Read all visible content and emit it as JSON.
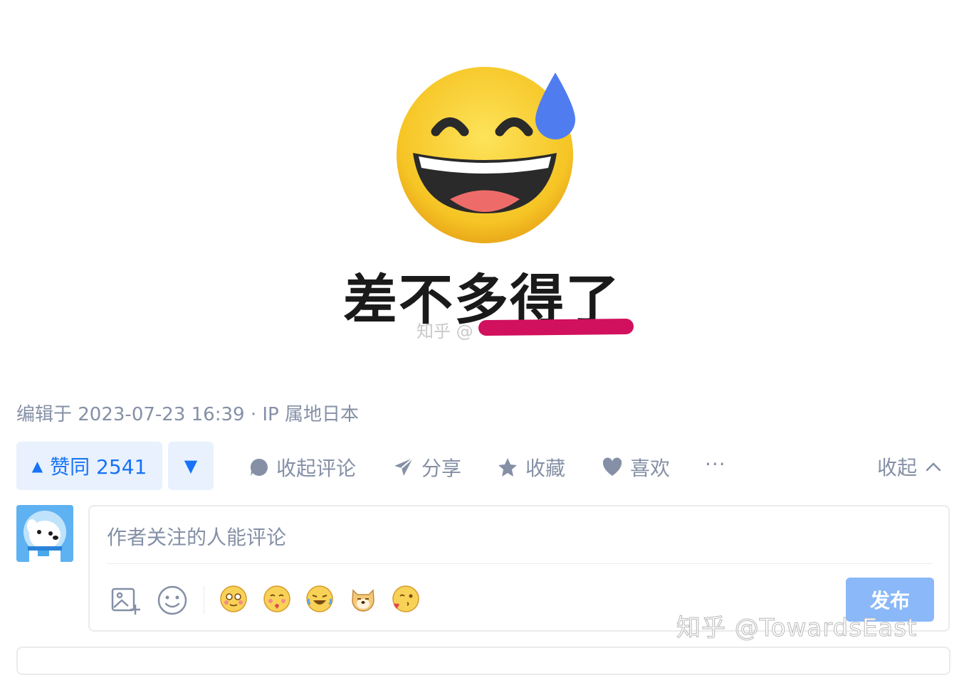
{
  "meme": {
    "caption": "差不多得了",
    "watermark_prefix": "知乎 @",
    "emoji_icon": "grinning-face-with-sweat-icon",
    "redaction_color": "#d1105e"
  },
  "post_meta": {
    "text": "编辑于 2023-07-23 16:39 · IP 属地日本"
  },
  "actions": {
    "upvote_label": "赞同 2541",
    "upvote_icon": "triangle-up-icon",
    "downvote_icon": "triangle-down-icon",
    "comment_label": "收起评论",
    "comment_icon": "comment-bubble-icon",
    "share_label": "分享",
    "share_icon": "paper-plane-icon",
    "favorite_label": "收藏",
    "favorite_icon": "star-icon",
    "like_label": "喜欢",
    "like_icon": "heart-icon",
    "more_label": "···",
    "collapse_label": "收起",
    "collapse_icon": "chevron-up-icon"
  },
  "comment_box": {
    "placeholder": "作者关注的人能评论",
    "tools": [
      "image-upload-icon",
      "emoji-picker-icon"
    ],
    "stickers": [
      "blushing-sticker-icon",
      "hugging-sticker-icon",
      "laughing-crying-sticker-icon",
      "doge-sticker-icon",
      "kissing-sticker-icon"
    ],
    "publish_label": "发布"
  },
  "watermark": {
    "text": "知乎 @TowardsEast"
  },
  "colors": {
    "brand_blue": "#1772f6",
    "vote_bg": "#e8f1fd",
    "muted_text": "#8590a6",
    "publish_disabled": "#8ab8f8"
  }
}
